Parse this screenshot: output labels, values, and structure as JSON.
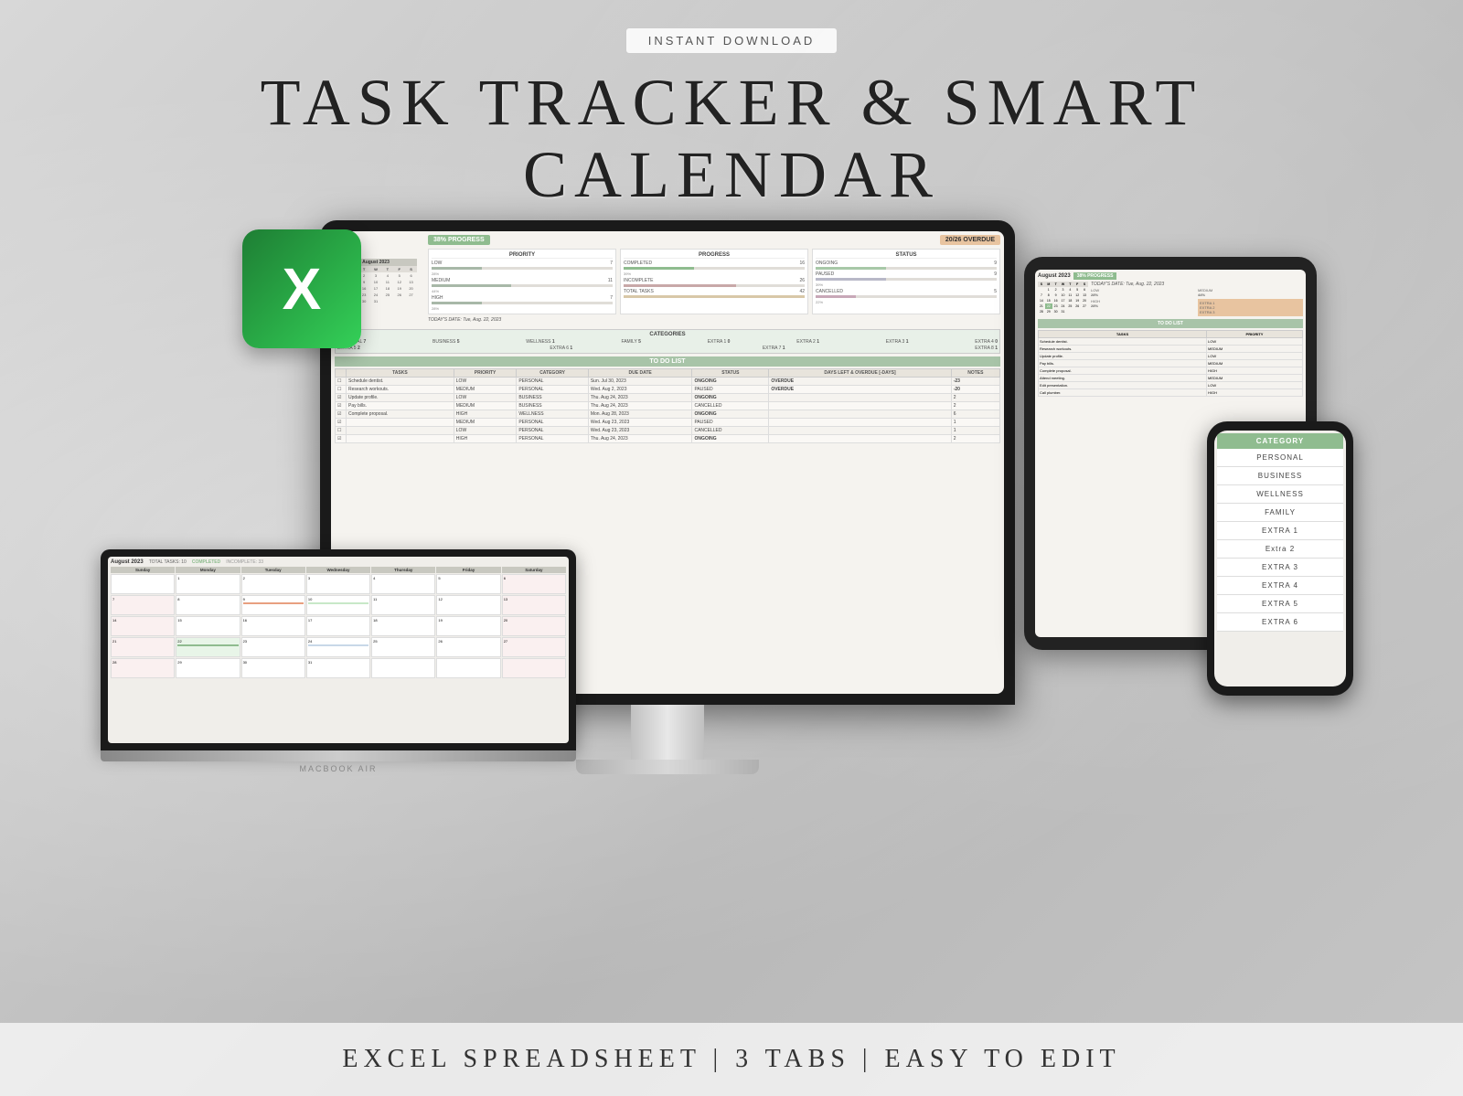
{
  "header": {
    "badge": "INSTANT DOWNLOAD",
    "title_line1": "TASK TRACKER & SMART",
    "title_line2": "CALENDAR"
  },
  "footer": {
    "text": "EXCEL SPREADSHEET  |  3 TABS  |  EASY TO EDIT"
  },
  "excel_icon": {
    "letter": "X"
  },
  "spreadsheet": {
    "month": "August 2023",
    "progress": "38% PROGRESS",
    "overdue": "20/26 OVERDUE",
    "todays_date_label": "TODAY'S DATE:",
    "todays_date": "Tue, Aug. 22, 2023",
    "priority": {
      "label": "PRIORITY",
      "low": "LOW",
      "low_count": "7",
      "low_pct": "28%",
      "medium": "MEDIUM",
      "medium_count": "11",
      "medium_pct": "44%",
      "high": "HIGH",
      "high_count": "7",
      "high_pct": "28%"
    },
    "progress_stats": {
      "label": "PROGRESS",
      "completed": "COMPLETED",
      "completed_count": "16",
      "completed_pct": "39%",
      "incomplete": "INCOMPLETE",
      "incomplete_count": "26",
      "paused": "PAUSED",
      "paused_count": "9",
      "paused_pct": "39%",
      "total": "TOTAL TASKS",
      "total_count": "42",
      "cancelled": "CANCELLED",
      "cancelled_count": "5",
      "cancelled_pct": "22%"
    },
    "status": {
      "label": "STATUS",
      "ongoing": "ONGOING",
      "ongoing_count": "9"
    },
    "categories": {
      "label": "CATEGORIES",
      "items": [
        {
          "name": "PERSONAL",
          "count": "7"
        },
        {
          "name": "BUSINESS",
          "count": "5"
        },
        {
          "name": "WELLNESS",
          "count": "1"
        },
        {
          "name": "FAMILY",
          "count": "5"
        },
        {
          "name": "EXTRA 1",
          "count": "0"
        },
        {
          "name": "EXTRA 2",
          "count": "1"
        },
        {
          "name": "EXTRA 3",
          "count": "1"
        },
        {
          "name": "EXTRA 4",
          "count": "0"
        },
        {
          "name": "EXTRA 5",
          "count": "2"
        },
        {
          "name": "EXTRA 6",
          "count": "1"
        },
        {
          "name": "EXTRA 7",
          "count": "1"
        },
        {
          "name": "EXTRA 8",
          "count": "1"
        }
      ]
    },
    "todo_list": {
      "label": "TO DO LIST",
      "columns": [
        "TASKS",
        "PRIORITY",
        "CATEGORY",
        "DUE DATE",
        "STATUS",
        "DAYS LEFT & OVERDUE [-DAYS]",
        "NOTES"
      ],
      "rows": [
        {
          "task": "Schedule dentist.",
          "priority": "LOW",
          "category": "PERSONAL",
          "due": "Sun. Jul 30, 2023",
          "status": "ONGOING",
          "days": "-23",
          "overdue": true
        },
        {
          "task": "Research workouts.",
          "priority": "MEDIUM",
          "category": "PERSONAL",
          "due": "Wed. Aug 2, 2023",
          "status": "PAUSED",
          "days": "-20",
          "overdue": true
        },
        {
          "task": "Update profile.",
          "priority": "LOW",
          "category": "BUSINESS",
          "due": "Thu. Aug 24, 2023",
          "status": "ONGOING",
          "days": "2"
        },
        {
          "task": "Pay bills.",
          "priority": "MEDIUM",
          "category": "BUSINESS",
          "due": "Thu. Aug 24, 2023",
          "status": "CANCELLED",
          "days": "2"
        },
        {
          "task": "Complete proposal.",
          "priority": "HIGH",
          "category": "WELLNESS",
          "due": "Mon. Aug 28, 2023",
          "status": "ONGOING",
          "days": "6"
        },
        {
          "task": "",
          "priority": "MEDIUM",
          "category": "PERSONAL",
          "due": "Wed. Aug 23, 2023",
          "status": "PAUSED",
          "days": "1"
        },
        {
          "task": "",
          "priority": "LOW",
          "category": "PERSONAL",
          "due": "Wed. Aug 23, 2023",
          "status": "CANCELLED",
          "days": "1"
        },
        {
          "task": "",
          "priority": "HIGH",
          "category": "PERSONAL",
          "due": "Thu. Aug 24, 2023",
          "status": "ONGOING",
          "days": "2"
        }
      ]
    }
  },
  "iphone": {
    "category_header": "CATEGORY",
    "categories": [
      "PERSONAL",
      "BUSINESS",
      "WELLNESS",
      "FAMILY",
      "EXTRA 1",
      "Extra 2",
      "EXTRA 3",
      "EXTRA 4",
      "EXTRA 5",
      "EXTRA 6"
    ]
  },
  "ipad": {
    "month": "August 2023",
    "progress": "38% PROGRESS"
  },
  "macbook": {
    "month": "August 2023",
    "label": "MACBOOK AIR"
  },
  "completed_badge": "COMPLETED"
}
